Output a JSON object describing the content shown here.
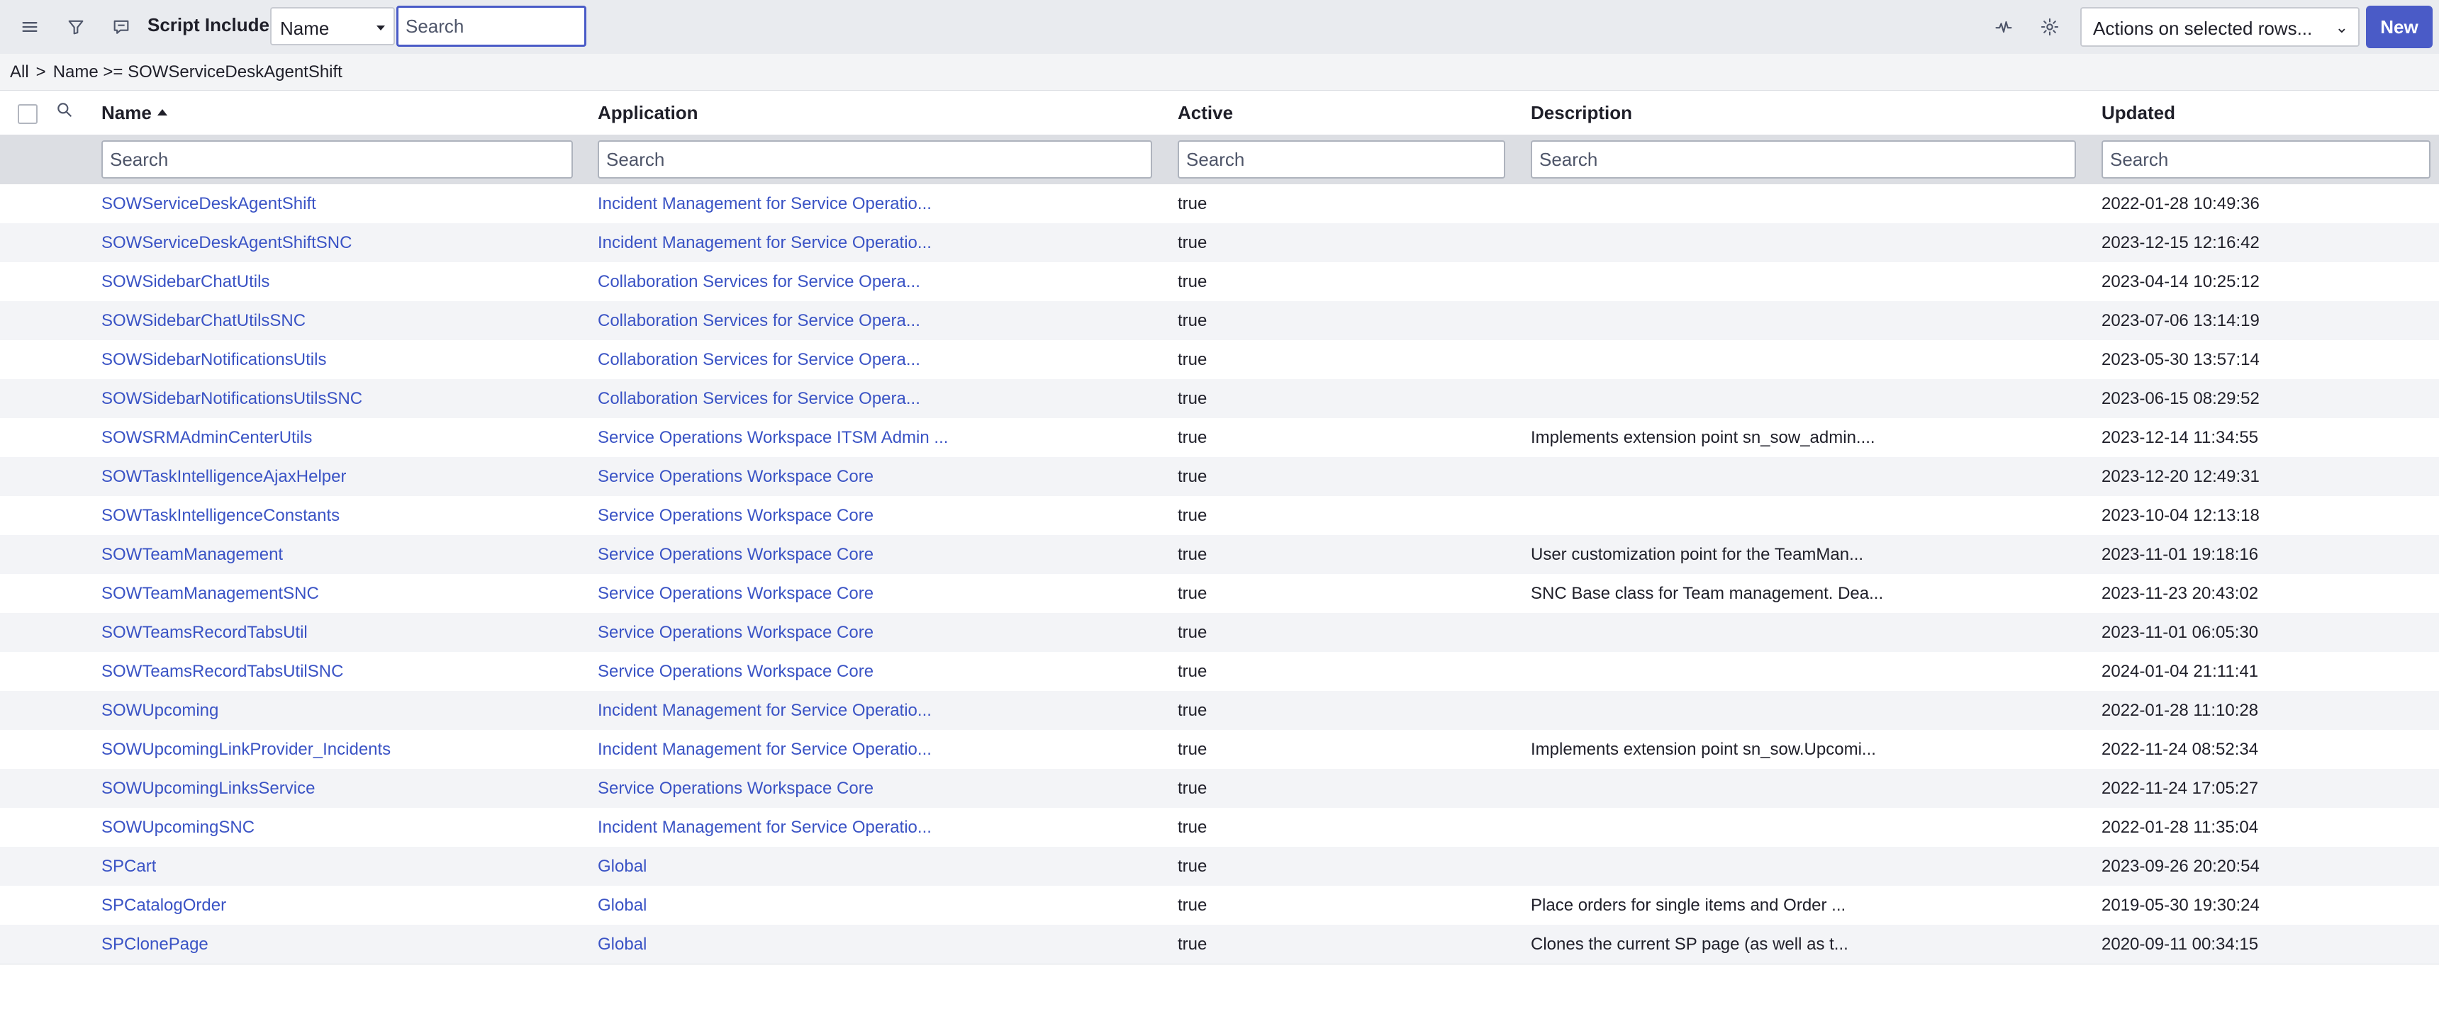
{
  "header": {
    "title": "Script Includes",
    "field_select": "Name",
    "search_placeholder": "Search",
    "actions_select": "Actions on selected rows...",
    "new_label": "New"
  },
  "breadcrumb": {
    "all": "All",
    "separator": ">",
    "condition": "Name >= SOWServiceDeskAgentShift"
  },
  "columns": {
    "name": "Name",
    "application": "Application",
    "active": "Active",
    "description": "Description",
    "updated": "Updated"
  },
  "filter_placeholder": "Search",
  "icons": {
    "menu": "hamburger-menu-icon",
    "filter": "funnel-icon",
    "chat": "chat-bubble-icon",
    "activity": "pulse-icon",
    "settings": "gear-icon",
    "column_search": "search-icon"
  },
  "colors": {
    "accent": "#4a5bc7",
    "link": "#3a53c5",
    "header_bg": "#e9ebef",
    "alt_row": "#f3f4f7"
  },
  "rows": [
    {
      "name": "SOWServiceDeskAgentShift",
      "application": "Incident Management for Service Operatio...",
      "active": "true",
      "description": "",
      "updated": "2022-01-28 10:49:36"
    },
    {
      "name": "SOWServiceDeskAgentShiftSNC",
      "application": "Incident Management for Service Operatio...",
      "active": "true",
      "description": "",
      "updated": "2023-12-15 12:16:42"
    },
    {
      "name": "SOWSidebarChatUtils",
      "application": "Collaboration Services for Service Opera...",
      "active": "true",
      "description": "",
      "updated": "2023-04-14 10:25:12"
    },
    {
      "name": "SOWSidebarChatUtilsSNC",
      "application": "Collaboration Services for Service Opera...",
      "active": "true",
      "description": "",
      "updated": "2023-07-06 13:14:19"
    },
    {
      "name": "SOWSidebarNotificationsUtils",
      "application": "Collaboration Services for Service Opera...",
      "active": "true",
      "description": "",
      "updated": "2023-05-30 13:57:14"
    },
    {
      "name": "SOWSidebarNotificationsUtilsSNC",
      "application": "Collaboration Services for Service Opera...",
      "active": "true",
      "description": "",
      "updated": "2023-06-15 08:29:52"
    },
    {
      "name": "SOWSRMAdminCenterUtils",
      "application": "Service Operations Workspace ITSM Admin ...",
      "active": "true",
      "description": "Implements extension point sn_sow_admin....",
      "updated": "2023-12-14 11:34:55"
    },
    {
      "name": "SOWTaskIntelligenceAjaxHelper",
      "application": "Service Operations Workspace Core",
      "active": "true",
      "description": "",
      "updated": "2023-12-20 12:49:31"
    },
    {
      "name": "SOWTaskIntelligenceConstants",
      "application": "Service Operations Workspace Core",
      "active": "true",
      "description": "",
      "updated": "2023-10-04 12:13:18"
    },
    {
      "name": "SOWTeamManagement",
      "application": "Service Operations Workspace Core",
      "active": "true",
      "description": "User customization point for the TeamMan...",
      "updated": "2023-11-01 19:18:16"
    },
    {
      "name": "SOWTeamManagementSNC",
      "application": "Service Operations Workspace Core",
      "active": "true",
      "description": "SNC Base class for Team management. Dea...",
      "updated": "2023-11-23 20:43:02"
    },
    {
      "name": "SOWTeamsRecordTabsUtil",
      "application": "Service Operations Workspace Core",
      "active": "true",
      "description": "",
      "updated": "2023-11-01 06:05:30"
    },
    {
      "name": "SOWTeamsRecordTabsUtilSNC",
      "application": "Service Operations Workspace Core",
      "active": "true",
      "description": "",
      "updated": "2024-01-04 21:11:41"
    },
    {
      "name": "SOWUpcoming",
      "application": "Incident Management for Service Operatio...",
      "active": "true",
      "description": "",
      "updated": "2022-01-28 11:10:28"
    },
    {
      "name": "SOWUpcomingLinkProvider_Incidents",
      "application": "Incident Management for Service Operatio...",
      "active": "true",
      "description": "Implements extension point sn_sow.Upcomi...",
      "updated": "2022-11-24 08:52:34"
    },
    {
      "name": "SOWUpcomingLinksService",
      "application": "Service Operations Workspace Core",
      "active": "true",
      "description": "",
      "updated": "2022-11-24 17:05:27"
    },
    {
      "name": "SOWUpcomingSNC",
      "application": "Incident Management for Service Operatio...",
      "active": "true",
      "description": "",
      "updated": "2022-01-28 11:35:04"
    },
    {
      "name": "SPCart",
      "application": "Global",
      "active": "true",
      "description": "",
      "updated": "2023-09-26 20:20:54"
    },
    {
      "name": "SPCatalogOrder",
      "application": "Global",
      "active": "true",
      "description": "Place orders for single items and Order ...",
      "updated": "2019-05-30 19:30:24"
    },
    {
      "name": "SPClonePage",
      "application": "Global",
      "active": "true",
      "description": "Clones the current SP page (as well as t...",
      "updated": "2020-09-11 00:34:15"
    }
  ]
}
